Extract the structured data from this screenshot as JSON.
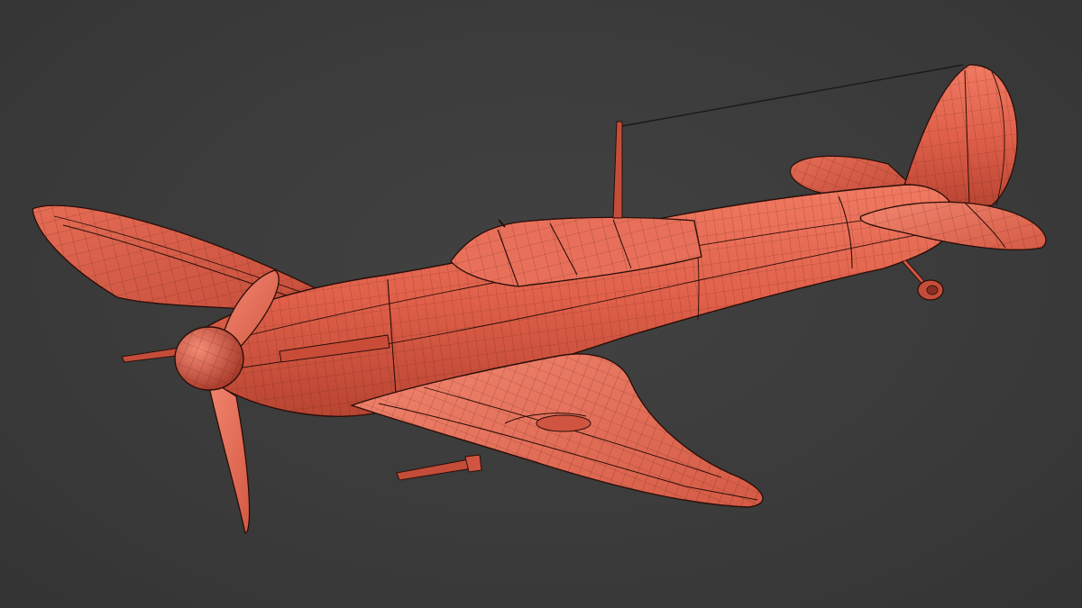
{
  "scene": {
    "background_color": "#3b3b3b",
    "model_color": "#e0604a",
    "wire_color": "#2a0e08",
    "model_subject": "spitfire-aircraft-wireframe-model"
  }
}
